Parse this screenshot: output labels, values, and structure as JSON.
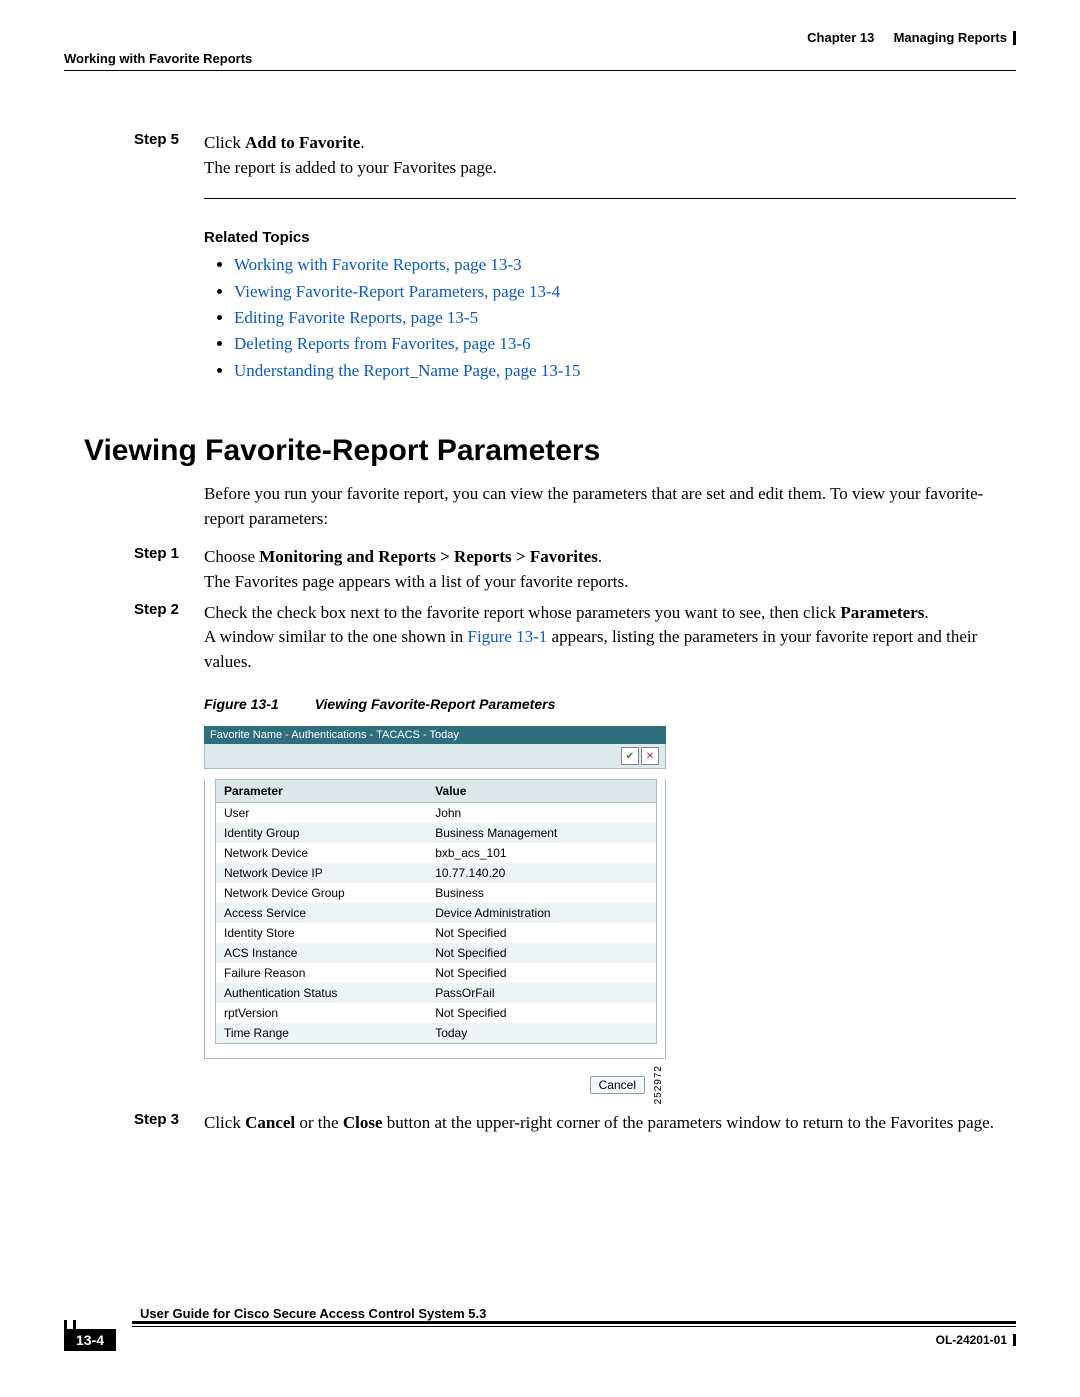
{
  "header": {
    "chapter_label": "Chapter 13",
    "chapter_title": "Managing Reports",
    "section_label": "Working with Favorite Reports"
  },
  "steps_top": {
    "step5": {
      "label": "Step 5",
      "line1_a": "Click ",
      "line1_b": "Add to Favorite",
      "line1_c": ".",
      "line2": "The report is added to your Favorites page."
    }
  },
  "related": {
    "heading": "Related Topics",
    "items": [
      "Working with Favorite Reports, page 13-3",
      "Viewing Favorite-Report Parameters, page 13-4",
      "Editing Favorite Reports, page 13-5",
      "Deleting Reports from Favorites, page 13-6",
      "Understanding the Report_Name Page, page 13-15"
    ]
  },
  "section_heading": "Viewing Favorite-Report Parameters",
  "intro": "Before you run your favorite report, you can view the parameters that are set and edit them. To view your favorite-report parameters:",
  "steps_main": {
    "step1": {
      "label": "Step 1",
      "a": "Choose ",
      "b": "Monitoring and Reports > Reports > Favorites",
      "c": ".",
      "line2": "The Favorites page appears with a list of your favorite reports."
    },
    "step2": {
      "label": "Step 2",
      "a": "Check the check box next to the favorite report whose parameters you want to see, then click ",
      "b": "Parameters",
      "c": ".",
      "line2a": "A window similar to the one shown in ",
      "line2b": "Figure 13-1",
      "line2c": " appears, listing the parameters in your favorite report and their values."
    },
    "step3": {
      "label": "Step 3",
      "a": "Click ",
      "b": "Cancel",
      "c": " or the ",
      "d": "Close",
      "e": " button at the upper-right corner of the parameters window to return to the Favorites page."
    }
  },
  "figure": {
    "caption_no": "Figure 13-1",
    "caption_text": "Viewing Favorite-Report Parameters",
    "titlebar": "Favorite Name - Authentications - TACACS - Today",
    "col_param": "Parameter",
    "col_value": "Value",
    "rows": [
      {
        "p": "User",
        "v": "John"
      },
      {
        "p": "Identity Group",
        "v": "Business Management"
      },
      {
        "p": "Network Device",
        "v": "bxb_acs_101"
      },
      {
        "p": "Network Device IP",
        "v": "10.77.140.20"
      },
      {
        "p": "Network Device Group",
        "v": "Business"
      },
      {
        "p": "Access Service",
        "v": "Device Administration"
      },
      {
        "p": "Identity Store",
        "v": "Not Specified"
      },
      {
        "p": "ACS Instance",
        "v": "Not Specified"
      },
      {
        "p": "Failure Reason",
        "v": "Not Specified"
      },
      {
        "p": "Authentication Status",
        "v": "PassOrFail"
      },
      {
        "p": "rptVersion",
        "v": "Not Specified"
      },
      {
        "p": "Time Range",
        "v": "Today"
      }
    ],
    "cancel": "Cancel",
    "imgnum": "252972"
  },
  "footer": {
    "title": "User Guide for Cisco Secure Access Control System 5.3",
    "page": "13-4",
    "docnum": "OL-24201-01"
  }
}
